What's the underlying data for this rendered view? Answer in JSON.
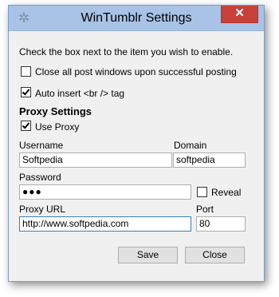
{
  "window": {
    "title": "WinTumblr Settings",
    "icon": "settings-gear-icon",
    "close_glyph": "✕"
  },
  "instructions": "Check the box next to the item you wish to enable.",
  "options": {
    "close_windows": {
      "label": "Close all post windows upon successful posting",
      "checked": false
    },
    "auto_insert": {
      "label": "Auto insert <br /> tag",
      "checked": true
    }
  },
  "proxy": {
    "section_title": "Proxy Settings",
    "use_proxy": {
      "label": "Use Proxy",
      "checked": true
    },
    "username_label": "Username",
    "username_value": "Softpedia",
    "domain_label": "Domain",
    "domain_value": "softpedia",
    "password_label": "Password",
    "password_value": "●●●",
    "reveal": {
      "label": "Reveal",
      "checked": false
    },
    "url_label": "Proxy URL",
    "url_value": "http://www.softpedia.com",
    "port_label": "Port",
    "port_value": "80"
  },
  "buttons": {
    "save": "Save",
    "close": "Close"
  },
  "colors": {
    "titlebar": "#a8c3e6",
    "close_button": "#c7403a",
    "focus_border": "#3c7fb1"
  }
}
